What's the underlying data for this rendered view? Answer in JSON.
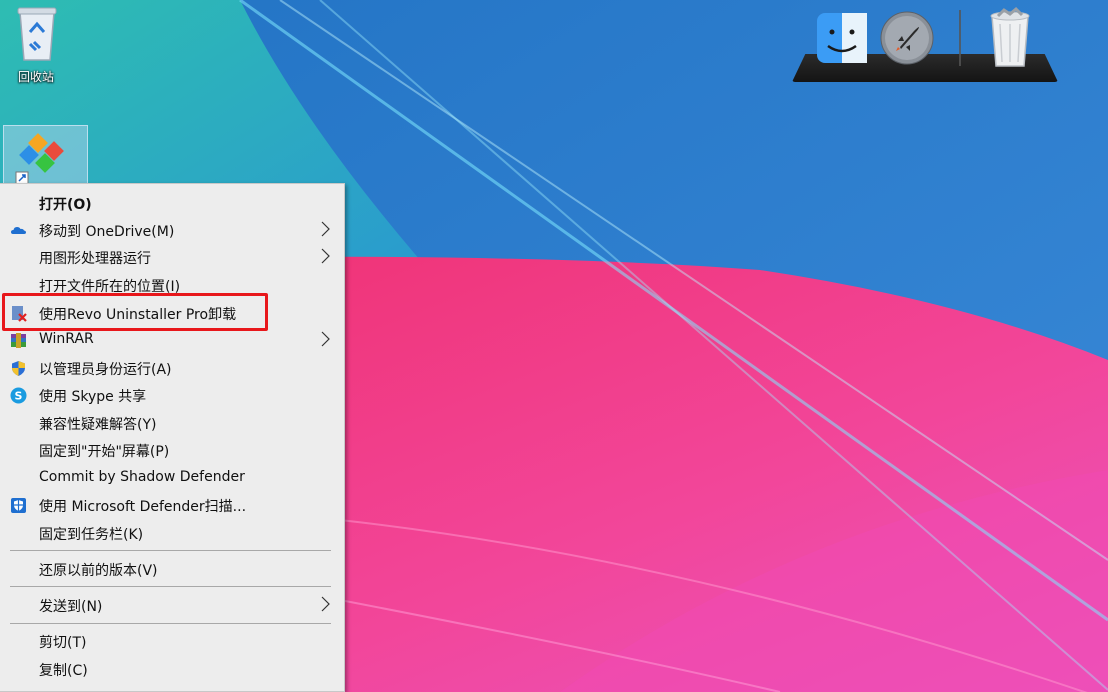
{
  "desktop": {
    "recycle_bin_label": "回收站"
  },
  "dock": {
    "items": [
      "finder-icon",
      "launchpad-icon",
      "trash-icon"
    ]
  },
  "context_menu": {
    "items": [
      {
        "label": "打开(O)",
        "bold": true
      },
      {
        "label": "移动到 OneDrive(M)",
        "icon": "onedrive-icon",
        "submenu": true
      },
      {
        "label": "用图形处理器运行",
        "submenu": true
      },
      {
        "label": "打开文件所在的位置(I)"
      },
      {
        "label": "使用Revo Uninstaller Pro卸载",
        "icon": "revo-uninstaller-icon"
      },
      {
        "label": "WinRAR",
        "icon": "winrar-icon",
        "submenu": true
      },
      {
        "label": "以管理员身份运行(A)",
        "icon": "uac-shield-icon"
      },
      {
        "label": "使用 Skype 共享",
        "icon": "skype-icon"
      },
      {
        "label": "兼容性疑难解答(Y)"
      },
      {
        "label": "固定到\"开始\"屏幕(P)"
      },
      {
        "label": "Commit by Shadow Defender"
      },
      {
        "label": "使用 Microsoft Defender扫描...",
        "icon": "defender-icon"
      },
      {
        "label": "固定到任务栏(K)"
      },
      {
        "label": "还原以前的版本(V)"
      },
      {
        "label": "发送到(N)",
        "submenu": true
      },
      {
        "label": "剪切(T)"
      },
      {
        "label": "复制(C)"
      }
    ]
  },
  "colors": {
    "highlight_border": "#e8171b",
    "menu_bg": "#ededed",
    "wallpaper_blue": "#2e7fd2",
    "wallpaper_pink": "#f1418e",
    "wallpaper_teal": "#27b9b5"
  }
}
